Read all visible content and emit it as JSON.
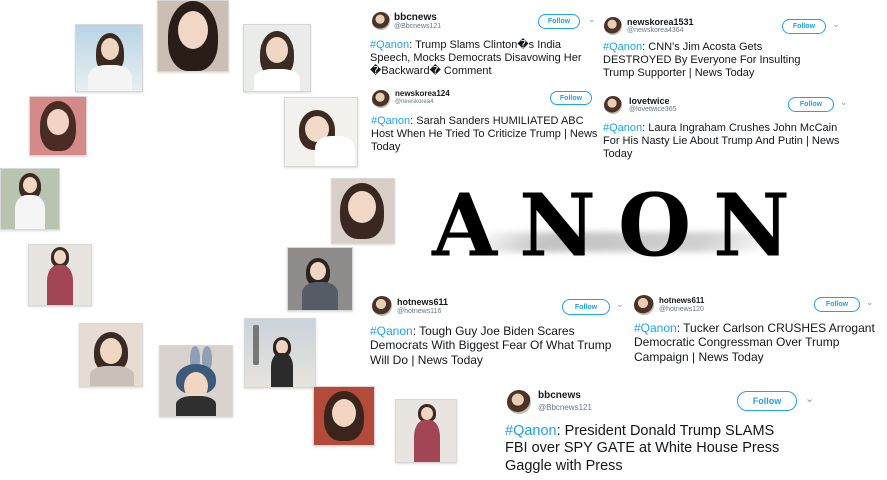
{
  "tweets": [
    {
      "name": "bbcnews",
      "handle": "@Bbcnews121",
      "follow": "Follow",
      "hashtag": "#Qanon",
      "text": ": Trump Slams Clinton�s India Speech, Mocks Democrats Disavowing Her �Backward� Comment"
    },
    {
      "name": "newskorea1531",
      "handle": "@newskorea4364",
      "follow": "Follow",
      "hashtag": "#Qanon",
      "text": ": CNN's Jim Acosta Gets DESTROYED By Everyone For Insulting Trump Supporter | News Today"
    },
    {
      "name": "newskorea124",
      "handle": "@newskorea4",
      "follow": "Follow",
      "hashtag": "#Qanon",
      "text": ": Sarah Sanders HUMILIATED ABC Host When He Tried To Criticize Trump | News Today"
    },
    {
      "name": "lovetwice",
      "handle": "@lovetwice365",
      "follow": "Follow",
      "hashtag": "#Qanon",
      "text": ": Laura Ingraham Crushes John McCain For His Nasty Lie About Trump And Putin | News Today"
    },
    {
      "name": "hotnews611",
      "handle": "@hotnews116",
      "follow": "Follow",
      "hashtag": "#Qanon",
      "text": ": Tough Guy Joe Biden Scares Democrats With Biggest Fear Of What Trump Will Do | News Today"
    },
    {
      "name": "hotnews611",
      "handle": "@hotnews120",
      "follow": "Follow",
      "hashtag": "#Qanon",
      "text": ": Tucker Carlson CRUSHES Arrogant Democratic Congressman Over Trump Campaign | News Today"
    },
    {
      "name": "bbcnews",
      "handle": "@Bbcnews121",
      "follow": "Follow",
      "hashtag": "#Qanon",
      "text": ": President Donald Trump SLAMS FBI over SPY GATE at White House Press Gaggle with Press"
    }
  ],
  "overlay_title": "ANON",
  "colors": {
    "link": "#1da1f2",
    "text": "#14171a",
    "muted": "#657786",
    "background": "#ffffff"
  }
}
